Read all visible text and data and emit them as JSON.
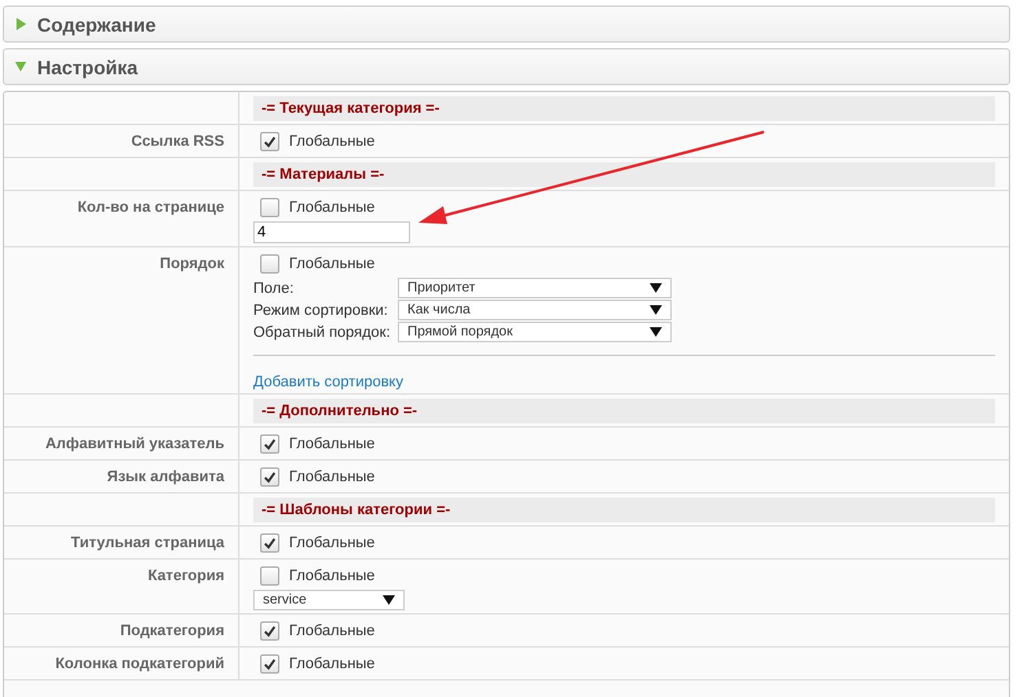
{
  "panels": [
    {
      "title": "Содержание",
      "expanded": false
    },
    {
      "title": "Настройка",
      "expanded": true
    }
  ],
  "rows": [
    {
      "label": "",
      "items": [
        {
          "kind": "section",
          "text": "-= Текущая категория =-"
        }
      ]
    },
    {
      "label": "Ссылка RSS",
      "items": [
        {
          "kind": "checkbox",
          "text": "Глобальные",
          "checked": true
        }
      ]
    },
    {
      "label": "",
      "items": [
        {
          "kind": "section",
          "text": "-= Материалы =-"
        }
      ]
    },
    {
      "label": "Кол-во на странице",
      "items": [
        {
          "kind": "checkbox",
          "text": "Глобальные",
          "checked": false
        },
        {
          "kind": "input",
          "value": "4"
        }
      ]
    },
    {
      "label": "Порядок",
      "items": [
        {
          "kind": "checkbox",
          "text": "Глобальные",
          "checked": false
        },
        {
          "kind": "select",
          "caption": "Поле:",
          "value": "Приоритет"
        },
        {
          "kind": "select",
          "caption": "Режим сортировки:",
          "value": "Как числа"
        },
        {
          "kind": "select",
          "caption": "Обратный порядок:",
          "value": "Прямой порядок"
        },
        {
          "kind": "divider"
        },
        {
          "kind": "link",
          "text": "Добавить сортировку"
        }
      ]
    },
    {
      "label": "",
      "items": [
        {
          "kind": "section",
          "text": "-= Дополнительно =-"
        }
      ]
    },
    {
      "label": "Алфавитный указатель",
      "items": [
        {
          "kind": "checkbox",
          "text": "Глобальные",
          "checked": true
        }
      ]
    },
    {
      "label": "Язык алфавита",
      "items": [
        {
          "kind": "checkbox",
          "text": "Глобальные",
          "checked": true
        }
      ]
    },
    {
      "label": "",
      "items": [
        {
          "kind": "section",
          "text": "-= Шаблоны категории =-"
        }
      ]
    },
    {
      "label": "Титульная страница",
      "items": [
        {
          "kind": "checkbox",
          "text": "Глобальные",
          "checked": true
        }
      ]
    },
    {
      "label": "Категория",
      "items": [
        {
          "kind": "checkbox",
          "text": "Глобальные",
          "checked": false
        },
        {
          "kind": "select",
          "value": "service"
        }
      ]
    },
    {
      "label": "Подкатегория",
      "items": [
        {
          "kind": "checkbox",
          "text": "Глобальные",
          "checked": true
        }
      ]
    },
    {
      "label": "Колонка подкатегорий",
      "items": [
        {
          "kind": "checkbox",
          "text": "Глобальные",
          "checked": true
        }
      ]
    }
  ]
}
